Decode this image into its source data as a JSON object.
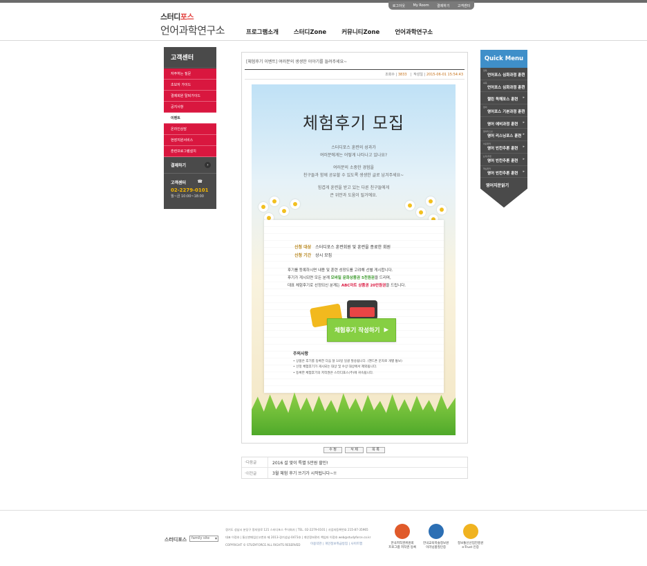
{
  "util": [
    "로그아웃",
    "My Room",
    "결제하기",
    "고객센터"
  ],
  "logo": {
    "line1a": "스터디",
    "line1b": "포스",
    "line2": "언어과학연구소"
  },
  "gnb": [
    "프로그램소개",
    "스터디Zone",
    "커뮤니티Zone",
    "언어과학연구소"
  ],
  "lnb": {
    "title": "고객센터",
    "items": [
      "자주하는 질문",
      "초보자 가이드",
      "결제회원 탈퇴가이드",
      "공지사항",
      "이벤트",
      "온라인상담",
      "현장지원서비스",
      "훈련프로그램설치"
    ],
    "active_index": 4,
    "pay": "결제하기",
    "cs_title": "고객센터",
    "phone": "02-2279-0101",
    "hours": "월~금 10:00~18:00"
  },
  "board": {
    "title": "[체험후기 이벤트] 여러분의 생생한 이야기를 들려주세요~",
    "views_label": "조회수",
    "views": "3833",
    "date_label": "작성일",
    "date": "2015-06-01 15:54:43"
  },
  "poster": {
    "headline": "체험후기 모집",
    "intro": [
      [
        "스터디포스 훈련의 성과가",
        "여러분에게는 어떻게 나타나고 있나요?"
      ],
      [
        "여러분의 소중한 경험을",
        "친구들과 함께 공유할 수 있도록 생생한 글로 남겨주세요~"
      ],
      [
        "힘겹게 훈련을 받고 있는 다른 친구들에게",
        "큰 위안과 도움이 될거에요."
      ]
    ],
    "target_key": "신청 대상",
    "target_val": "스터디포스 훈련회원 및 훈련을 종료한 회원",
    "period_key": "신청 기간",
    "period_val": "상시 모집",
    "desc1": "후기를 등록하시면 내용 및 훈련 성장도를 고려해 선별 게시합니다.",
    "desc2a": "후기가 게시되면 모든 분께 ",
    "desc2b": "모바일 문화상품권 5천원권",
    "desc2c": "을 드리며,",
    "desc3a": "대표 체험후기로 선정되신 분께는 ",
    "desc3b": "ABC마트 상품권 20만원권",
    "desc3c": "을 드립니다.",
    "button": "체험후기 작성하기",
    "notes_title": "주의사항",
    "notes": [
      "• 상품은 후기를 등록한 다음 달 10일 일괄 발송됩니다. (핸드폰 문자로 개별 통보)",
      "• 선정 체험후기가 게시되는 대상 및 수상 대상에서 제외됩니다.",
      "• 등록한 체험후기의 저작권은 스터디포스(주)에 귀속됩니다."
    ]
  },
  "actions": [
    "수 정",
    "삭 제",
    "목 록"
  ],
  "nav": [
    {
      "label": "다음글",
      "title": "2016 설 맞이 특별 5만원 할인!"
    },
    {
      "label": "이전글",
      "title": "3월 체험 후기 쓰기가 시작됩니다~!!"
    }
  ],
  "quick": {
    "title": "Quick Menu",
    "items": [
      {
        "small": "정독",
        "main": "언어포스 심화과정 훈련"
      },
      {
        "small": "속독",
        "main": "언어포스 심화과정 훈련"
      },
      {
        "small": "",
        "main": "챌린 독해포스 훈련"
      },
      {
        "small": "영어",
        "main": "영어포스 기본과정 훈련"
      },
      {
        "small": "",
        "main": "영어 에비과정 훈련"
      },
      {
        "small": "영어리스닝",
        "main": "영어 리스닝포스 훈련"
      },
      {
        "small": "어휘파악",
        "main": "영어 빈칸추론 훈련"
      },
      {
        "small": "논리/추론",
        "main": "영어 빈칸추론 훈련"
      },
      {
        "small": "핵심파악",
        "main": "영어 빈칸추론 훈련"
      }
    ],
    "last": "영어지문읽기"
  },
  "footer": {
    "logo": "스터디포스",
    "family": "family site",
    "lines": [
      "경기도 성남시 분당구 정자일로 121 스터디포스 주식회사 | TEL. 02-2279-0101 | 사업자등록번호 215-87-35965",
      "대표 이정호 | 통신판매업신고번호 제 2013-경기성남-0473호 | 개인정보관리 책임자 이정호 web@studyforce.co.kr",
      "COPYRIGHT © STUDYFORCE ALL RIGHTS RESERVED"
    ],
    "links": "이용약관  |  개인정보취급방침  |  사이트맵",
    "certs": [
      {
        "name": "한국저작권위원회",
        "sub": "프로그램 저작권 등록",
        "color": "#e05a2a"
      },
      {
        "name": "한국교육학술정보원",
        "sub": "이러닝품질인증",
        "color": "#2c6fb4"
      },
      {
        "name": "정보통신산업진흥원",
        "sub": "e-Trust 인증",
        "color": "#f0b320"
      }
    ]
  }
}
